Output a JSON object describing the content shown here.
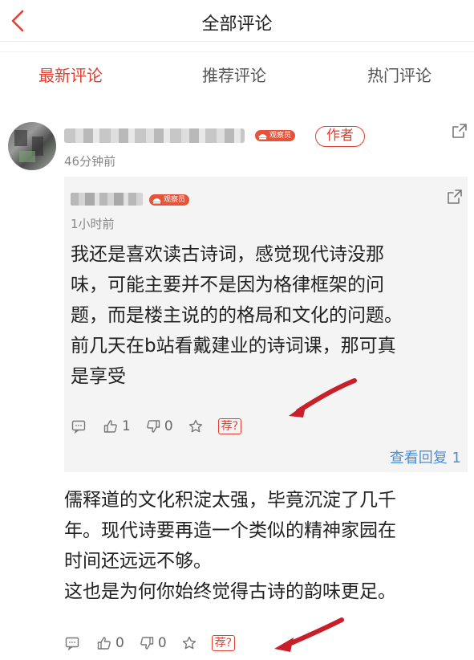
{
  "header": {
    "title": "全部评论"
  },
  "tabs": [
    {
      "label": "最新评论",
      "active": true
    },
    {
      "label": "推荐评论",
      "active": false
    },
    {
      "label": "热门评论",
      "active": false
    }
  ],
  "comment": {
    "badge_text": "观察员",
    "author_tag": "作者",
    "time": "46分钟前",
    "text_lines": [
      "儒释道的文化积淀太强，毕竟沉淀了几千",
      "年。现代诗要再造一个类似的精神家园在",
      "时间还远远不够。",
      "这也是为何你始终觉得古诗的韵味更足。"
    ],
    "likes": "0",
    "dislikes": "0",
    "recommend_label": "荐?"
  },
  "quoted": {
    "badge_text": "观察员",
    "time": "1小时前",
    "text_lines": [
      "我还是喜欢读古诗词，感觉现代诗没那",
      "味，可能主要并不是因为格律框架的问",
      "题，而是楼主说的的格局和文化的问题。",
      "前几天在b站看戴建业的诗词课，那可真",
      "是享受"
    ],
    "likes": "1",
    "dislikes": "0",
    "recommend_label": "荐?",
    "view_replies": "查看回复 1"
  },
  "colors": {
    "accent": "#e53d30",
    "link": "#4a8fd3",
    "quote_bg": "#f4f4f4"
  }
}
